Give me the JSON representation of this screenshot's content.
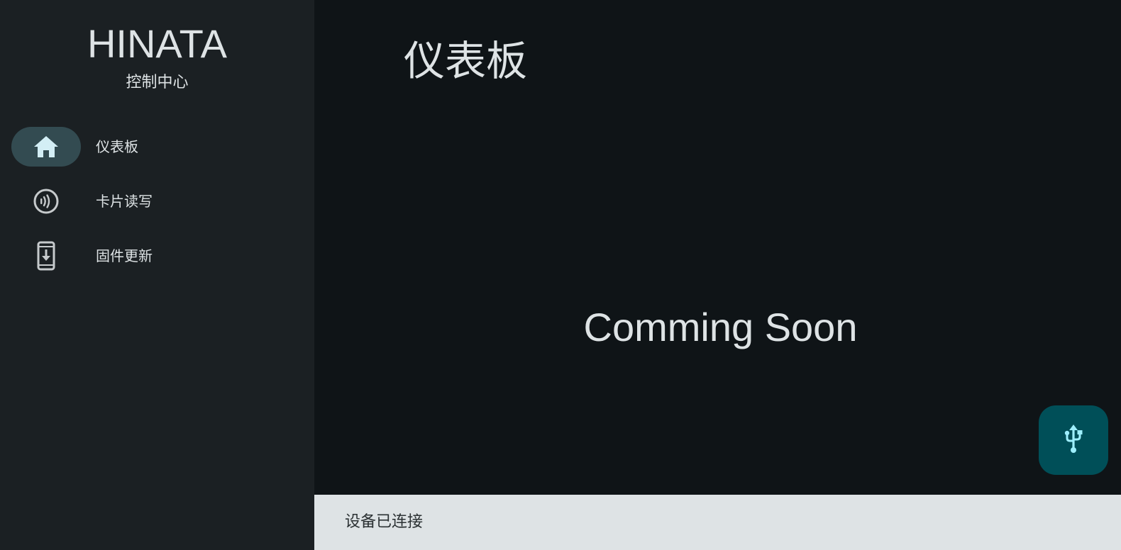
{
  "sidebar": {
    "brand_title": "HINATA",
    "brand_subtitle": "控制中心",
    "items": [
      {
        "label": "仪表板",
        "icon": "home-icon",
        "active": true
      },
      {
        "label": "卡片读写",
        "icon": "nfc-icon",
        "active": false
      },
      {
        "label": "固件更新",
        "icon": "phone-download-icon",
        "active": false
      }
    ]
  },
  "main": {
    "title": "仪表板",
    "placeholder": "Comming Soon"
  },
  "fab": {
    "icon": "usb-icon"
  },
  "snackbar": {
    "text": "设备已连接"
  },
  "colors": {
    "background": "#0f1417",
    "sidebar": "#1b2023",
    "active_indicator": "#334b51",
    "fab": "#004f58",
    "fab_icon": "#9eeffd",
    "snackbar": "#dee3e5",
    "text": "#dee3e5"
  }
}
